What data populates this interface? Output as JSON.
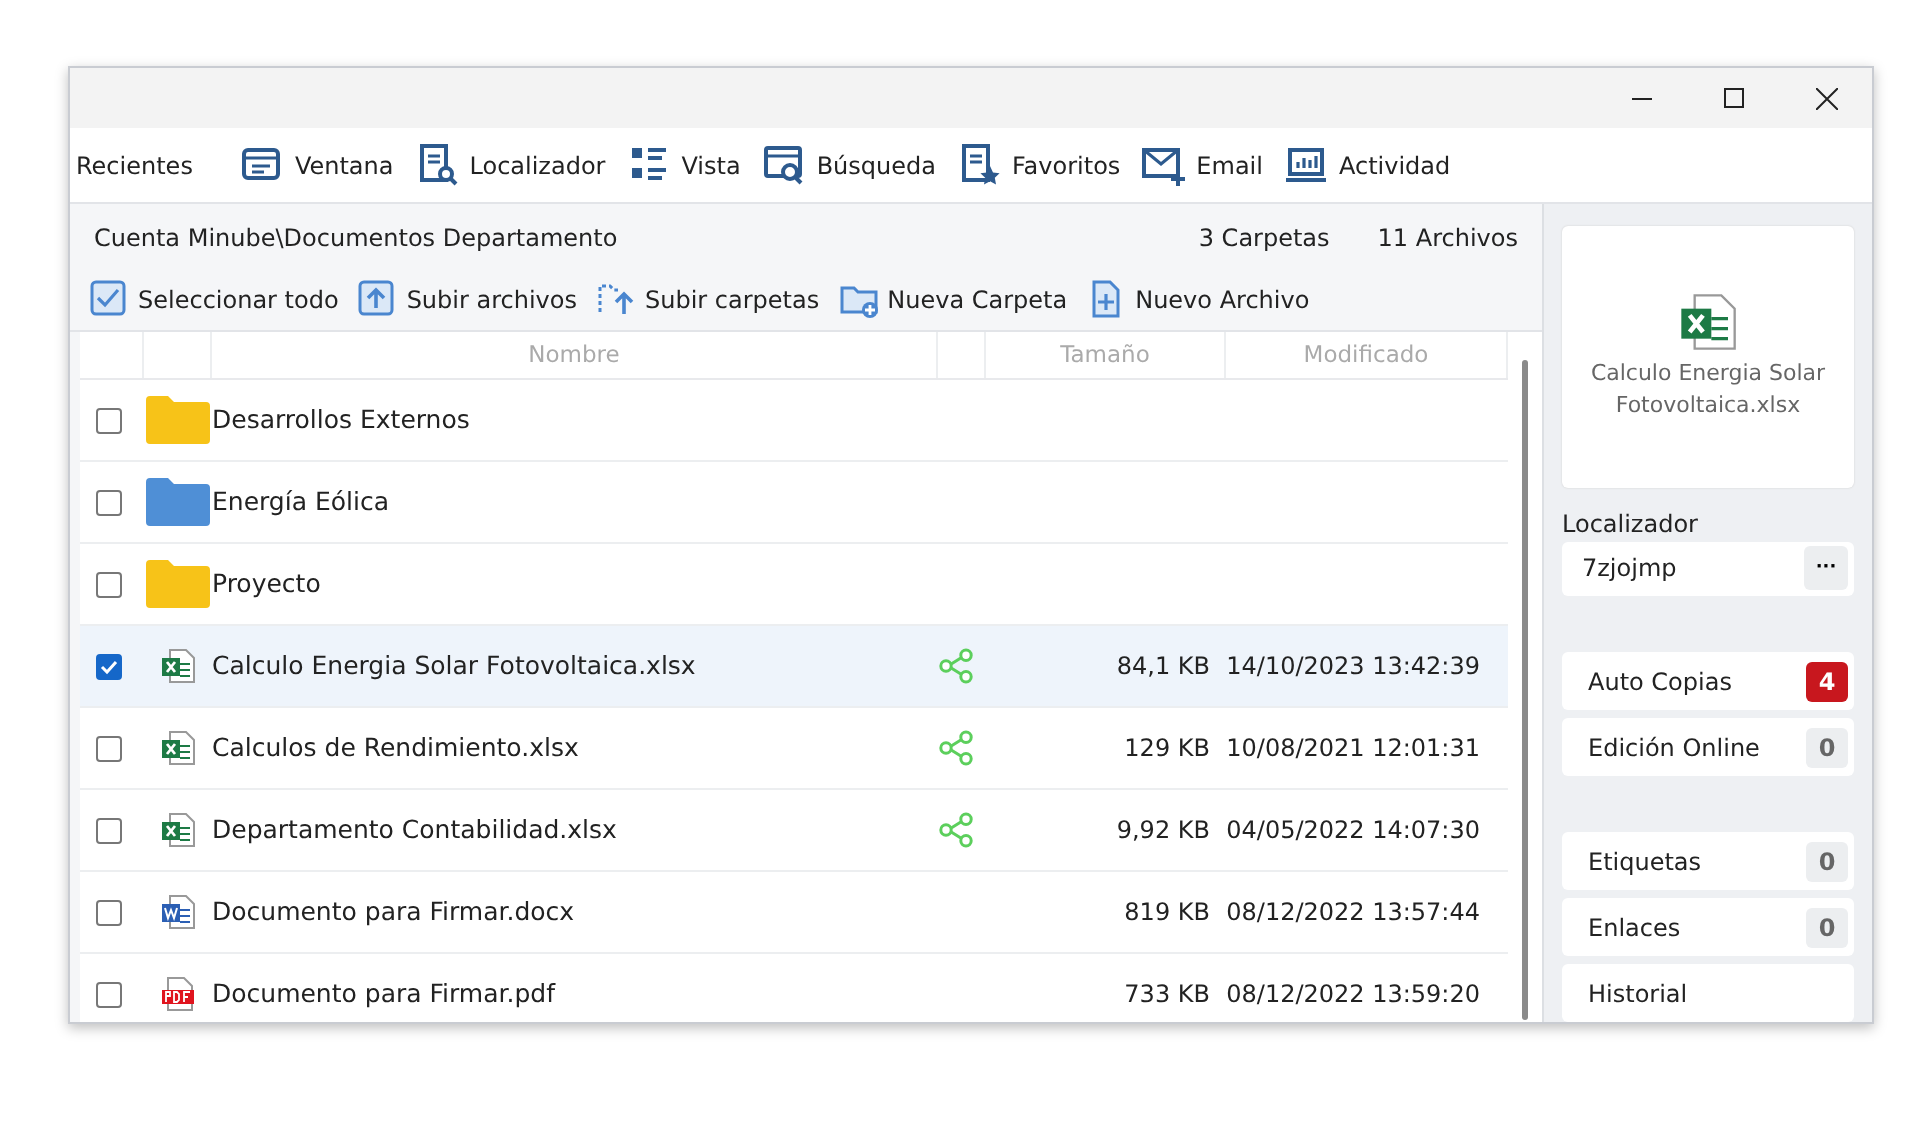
{
  "menu": [
    "Recientes",
    "Ventana",
    "Localizador",
    "Vista",
    "Búsqueda",
    "Favoritos",
    "Email",
    "Actividad"
  ],
  "path": "Cuenta Minube\\Documentos Departamento",
  "counts": [
    "3 Carpetas",
    "11 Archivos"
  ],
  "actions": [
    "Seleccionar todo",
    "Subir archivos",
    "Subir carpetas",
    "Nueva Carpeta",
    "Nuevo Archivo"
  ],
  "table": {
    "columns": [
      "Nombre",
      "Tamaño",
      "Modificado"
    ],
    "rows": [
      {
        "kind": "folder",
        "color": "#f7c318",
        "name": "Desarrollos Externos",
        "checked": false,
        "selected": false,
        "shared": false
      },
      {
        "kind": "folder",
        "color": "#4f8fd6",
        "name": "Energía Eólica",
        "checked": false,
        "selected": false,
        "shared": false
      },
      {
        "kind": "folder",
        "color": "#f7c318",
        "name": "Proyecto",
        "checked": false,
        "selected": false,
        "shared": false
      },
      {
        "kind": "xlsx",
        "name": "Calculo Energia Solar Fotovoltaica.xlsx",
        "checked": true,
        "selected": true,
        "shared": true,
        "size": "84,1 KB",
        "modified": "14/10/2023 13:42:39"
      },
      {
        "kind": "xlsx",
        "name": "Calculos de Rendimiento.xlsx",
        "checked": false,
        "selected": false,
        "shared": true,
        "size": "129 KB",
        "modified": "10/08/2021 12:01:31"
      },
      {
        "kind": "xlsx",
        "name": "Departamento Contabilidad.xlsx",
        "checked": false,
        "selected": false,
        "shared": true,
        "size": "9,92 KB",
        "modified": "04/05/2022 14:07:30"
      },
      {
        "kind": "docx",
        "name": "Documento para Firmar.docx",
        "checked": false,
        "selected": false,
        "shared": false,
        "size": "819 KB",
        "modified": "08/12/2022 13:57:44"
      },
      {
        "kind": "pdf",
        "name": "Documento para Firmar.pdf",
        "checked": false,
        "selected": false,
        "shared": false,
        "size": "733 KB",
        "modified": "08/12/2022 13:59:20"
      }
    ]
  },
  "preview": {
    "file_name": "Calculo Energia Solar Fotovoltaica.xlsx"
  },
  "locator": {
    "label": "Localizador",
    "value": "7zjojmp",
    "button": "···"
  },
  "panel_groups": [
    [
      {
        "label": "Auto Copias",
        "count": "4",
        "alert": true
      },
      {
        "label": "Edición Online",
        "count": "0",
        "alert": false
      }
    ],
    [
      {
        "label": "Etiquetas",
        "count": "0",
        "alert": false
      },
      {
        "label": "Enlaces",
        "count": "0",
        "alert": false
      },
      {
        "label": "Historial"
      }
    ]
  ]
}
